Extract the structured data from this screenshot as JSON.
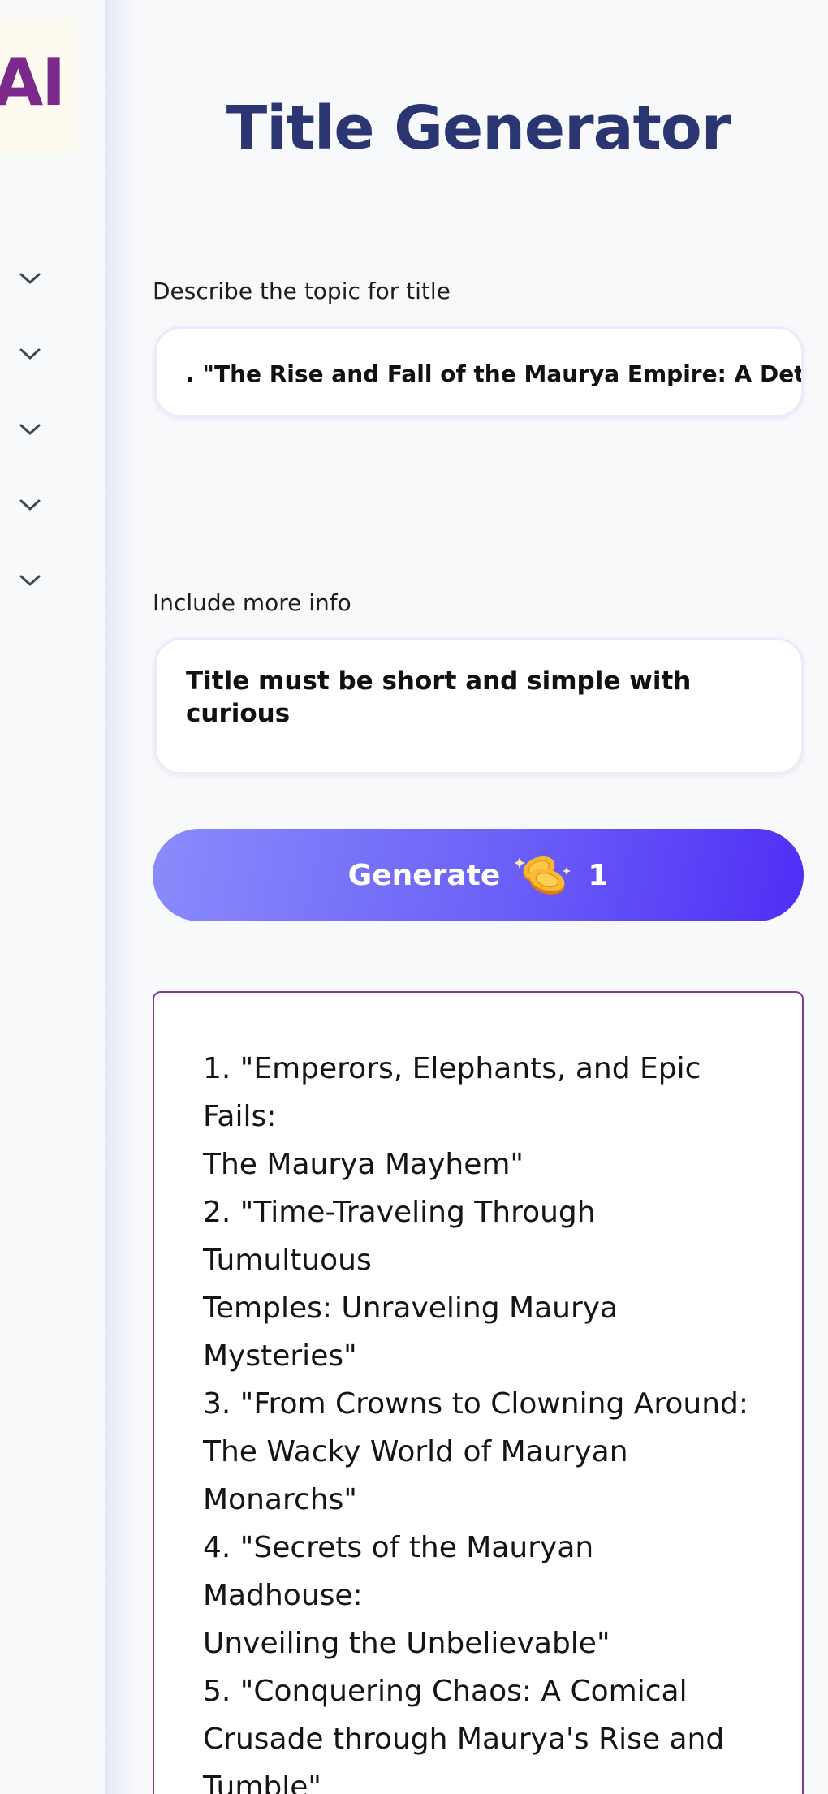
{
  "sidebar": {
    "logo_text": "AI",
    "sections": [
      {
        "icon": "chevron-down-icon"
      },
      {
        "icon": "chevron-down-icon"
      },
      {
        "icon": "chevron-down-icon"
      },
      {
        "icon": "chevron-down-icon"
      },
      {
        "icon": "chevron-down-icon"
      }
    ]
  },
  "header": {
    "title": "Title Generator"
  },
  "form": {
    "topic": {
      "label": "Describe the topic for title",
      "value": ". \"The Rise and Fall of the Maurya Empire: A Detailed"
    },
    "more_info": {
      "label": "Include more info",
      "value": "Title must be short and simple with curious"
    },
    "generate": {
      "label": "Generate",
      "icon": "coins-icon",
      "cost": "1"
    }
  },
  "output": {
    "lines": [
      "1. \"Emperors, Elephants, and Epic Fails:",
      "The Maurya Mayhem\"",
      "2. \"Time-Traveling Through Tumultuous",
      "Temples: Unraveling Maurya Mysteries\"",
      "3. \"From Crowns to Clowning Around:",
      "The Wacky World of Mauryan",
      "Monarchs\"",
      "4. \"Secrets of the Mauryan Madhouse:",
      "Unveiling the Unbelievable\"",
      "5. \"Conquering Chaos: A Comical",
      "Crusade through Maurya's Rise and",
      "Tumble\""
    ]
  },
  "colors": {
    "title": "#2b3572",
    "logo": "#7b2a8c",
    "button_start": "#8a8cfb",
    "button_end": "#4f2ef6",
    "output_border": "#7d3e95"
  }
}
